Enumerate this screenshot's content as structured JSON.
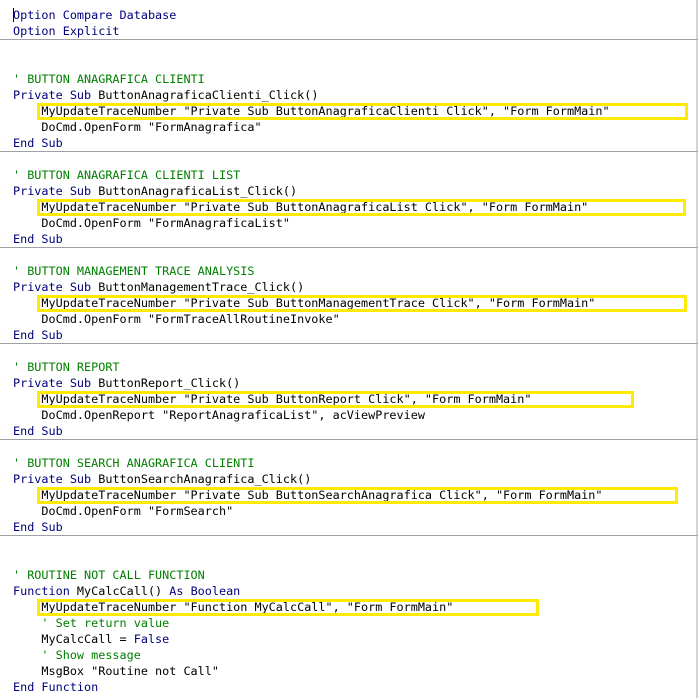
{
  "code_window": {
    "lines": [
      {
        "id": "l0",
        "segs": [
          {
            "c": "kw",
            "t": "Option Compare Database"
          }
        ]
      },
      {
        "id": "l1",
        "segs": [
          {
            "c": "kw",
            "t": "Option Explicit"
          }
        ]
      },
      {
        "id": "l2",
        "segs": []
      },
      {
        "id": "l3",
        "segs": []
      },
      {
        "id": "l4",
        "segs": [
          {
            "c": "cm",
            "t": "' BUTTON ANAGRAFICA CLIENTI"
          }
        ]
      },
      {
        "id": "l5",
        "segs": [
          {
            "c": "kw",
            "t": "Private Sub"
          },
          {
            "c": "",
            "t": " ButtonAnagraficaClienti_Click()"
          }
        ]
      },
      {
        "id": "l6",
        "segs": [
          {
            "c": "",
            "t": "    MyUpdateTraceNumber \"Private Sub ButtonAnagraficaClienti_Click\", \"Form_FormMain\""
          }
        ]
      },
      {
        "id": "l7",
        "segs": [
          {
            "c": "",
            "t": "    DoCmd.OpenForm \"FormAnagrafica\""
          }
        ]
      },
      {
        "id": "l8",
        "segs": [
          {
            "c": "kw",
            "t": "End Sub"
          }
        ]
      },
      {
        "id": "l9",
        "segs": []
      },
      {
        "id": "l10",
        "segs": [
          {
            "c": "cm",
            "t": "' BUTTON ANAGRAFICA CLIENTI LIST"
          }
        ]
      },
      {
        "id": "l11",
        "segs": [
          {
            "c": "kw",
            "t": "Private Sub"
          },
          {
            "c": "",
            "t": " ButtonAnagraficaList_Click()"
          }
        ]
      },
      {
        "id": "l12",
        "segs": [
          {
            "c": "",
            "t": "    MyUpdateTraceNumber \"Private Sub ButtonAnagraficaList_Click\", \"Form_FormMain\""
          }
        ]
      },
      {
        "id": "l13",
        "segs": [
          {
            "c": "",
            "t": "    DoCmd.OpenForm \"FormAnagraficaList\""
          }
        ]
      },
      {
        "id": "l14",
        "segs": [
          {
            "c": "kw",
            "t": "End Sub"
          }
        ]
      },
      {
        "id": "l15",
        "segs": []
      },
      {
        "id": "l16",
        "segs": [
          {
            "c": "cm",
            "t": "' BUTTON MANAGEMENT TRACE ANALYSIS"
          }
        ]
      },
      {
        "id": "l17",
        "segs": [
          {
            "c": "kw",
            "t": "Private Sub"
          },
          {
            "c": "",
            "t": " ButtonManagementTrace_Click()"
          }
        ]
      },
      {
        "id": "l18",
        "segs": [
          {
            "c": "",
            "t": "    MyUpdateTraceNumber \"Private Sub ButtonManagementTrace_Click\", \"Form_FormMain\""
          }
        ]
      },
      {
        "id": "l19",
        "segs": [
          {
            "c": "",
            "t": "    DoCmd.OpenForm \"FormTraceAllRoutineInvoke\""
          }
        ]
      },
      {
        "id": "l20",
        "segs": [
          {
            "c": "kw",
            "t": "End Sub"
          }
        ]
      },
      {
        "id": "l21",
        "segs": []
      },
      {
        "id": "l22",
        "segs": [
          {
            "c": "cm",
            "t": "' BUTTON REPORT"
          }
        ]
      },
      {
        "id": "l23",
        "segs": [
          {
            "c": "kw",
            "t": "Private Sub"
          },
          {
            "c": "",
            "t": " ButtonReport_Click()"
          }
        ]
      },
      {
        "id": "l24",
        "segs": [
          {
            "c": "",
            "t": "    MyUpdateTraceNumber \"Private Sub ButtonReport_Click\", \"Form_FormMain\""
          }
        ]
      },
      {
        "id": "l25",
        "segs": [
          {
            "c": "",
            "t": "    DoCmd.OpenReport \"ReportAnagraficaList\", acViewPreview"
          }
        ]
      },
      {
        "id": "l26",
        "segs": [
          {
            "c": "kw",
            "t": "End Sub"
          }
        ]
      },
      {
        "id": "l27",
        "segs": []
      },
      {
        "id": "l28",
        "segs": [
          {
            "c": "cm",
            "t": "' BUTTON SEARCH ANAGRAFICA CLIENTI"
          }
        ]
      },
      {
        "id": "l29",
        "segs": [
          {
            "c": "kw",
            "t": "Private Sub"
          },
          {
            "c": "",
            "t": " ButtonSearchAnagrafica_Click()"
          }
        ]
      },
      {
        "id": "l30",
        "segs": [
          {
            "c": "",
            "t": "    MyUpdateTraceNumber \"Private Sub ButtonSearchAnagrafica_Click\", \"Form_FormMain\""
          }
        ]
      },
      {
        "id": "l31",
        "segs": [
          {
            "c": "",
            "t": "    DoCmd.OpenForm \"FormSearch\""
          }
        ]
      },
      {
        "id": "l32",
        "segs": [
          {
            "c": "kw",
            "t": "End Sub"
          }
        ]
      },
      {
        "id": "l33",
        "segs": []
      },
      {
        "id": "l34",
        "segs": []
      },
      {
        "id": "l35",
        "segs": [
          {
            "c": "cm",
            "t": "' ROUTINE NOT CALL FUNCTION"
          }
        ]
      },
      {
        "id": "l36",
        "segs": [
          {
            "c": "kw",
            "t": "Function"
          },
          {
            "c": "",
            "t": " MyCalcCall() "
          },
          {
            "c": "kw",
            "t": "As Boolean"
          }
        ]
      },
      {
        "id": "l37",
        "segs": [
          {
            "c": "",
            "t": "    MyUpdateTraceNumber \"Function MyCalcCall\", \"Form_FormMain\""
          }
        ]
      },
      {
        "id": "l38",
        "segs": [
          {
            "c": "cm",
            "t": "    ' Set return value"
          }
        ]
      },
      {
        "id": "l39",
        "segs": [
          {
            "c": "",
            "t": "    MyCalcCall = "
          },
          {
            "c": "kw",
            "t": "False"
          }
        ]
      },
      {
        "id": "l40",
        "segs": [
          {
            "c": "cm",
            "t": "    ' Show message"
          }
        ]
      },
      {
        "id": "l41",
        "segs": [
          {
            "c": "",
            "t": "    MsgBox \"Routine not Call\""
          }
        ]
      },
      {
        "id": "l42",
        "segs": [
          {
            "c": "kw",
            "t": "End Function"
          }
        ]
      }
    ],
    "highlight_color": "#ffeb00",
    "keyword_color": "#00007f",
    "comment_color": "#007f00"
  }
}
